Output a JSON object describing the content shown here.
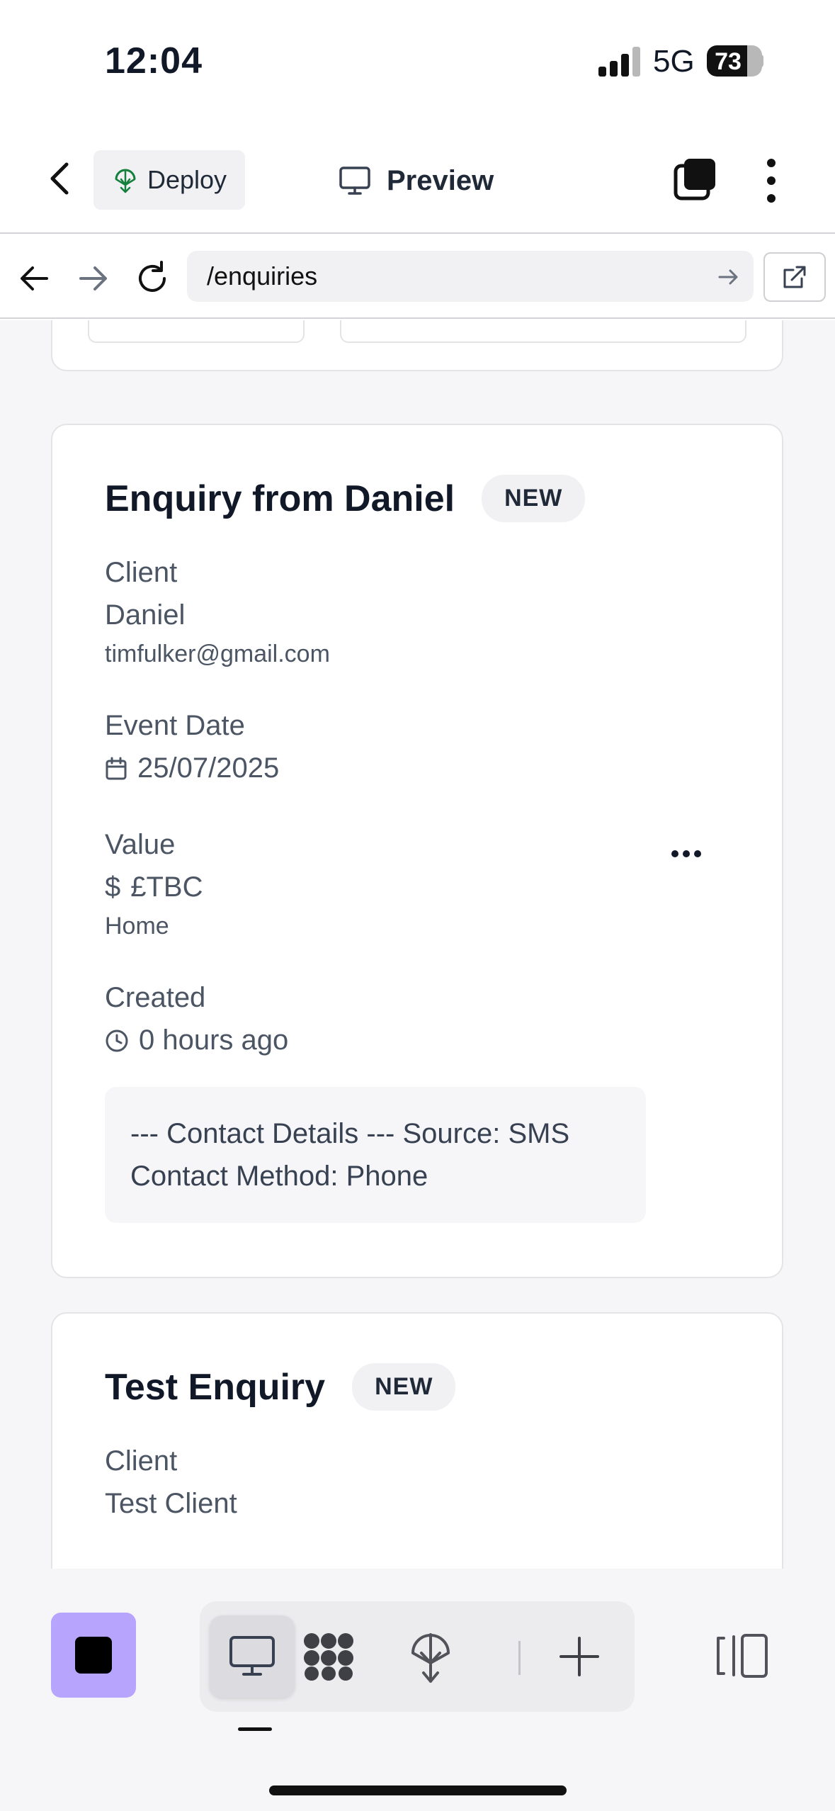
{
  "status_bar": {
    "time": "12:04",
    "network": "5G",
    "battery_percent": "73"
  },
  "header": {
    "deploy_label": "Deploy",
    "preview_label": "Preview",
    "icons": [
      "chevron-left-icon",
      "deploy-icon",
      "monitor-icon",
      "tabs-icon",
      "more-vertical-icon"
    ]
  },
  "browser": {
    "url": "/enquiries"
  },
  "enquiries": [
    {
      "title": "Enquiry from Daniel",
      "status": "NEW",
      "client_label": "Client",
      "client_name": "Daniel",
      "client_email": "timfulker@gmail.com",
      "event_date_label": "Event Date",
      "event_date": "25/07/2025",
      "value_label": "Value",
      "value": "£TBC",
      "value_currency_symbol": "$",
      "venue": "Home",
      "created_label": "Created",
      "created": "0 hours ago",
      "notes": "--- Contact Details --- Source: SMS Contact Method: Phone"
    },
    {
      "title": "Test Enquiry",
      "status": "NEW",
      "client_label": "Client",
      "client_name": "Test Client"
    }
  ],
  "toolbar": {
    "items": [
      "monitor-icon",
      "apps-icon",
      "deploy-icon",
      "plus-icon"
    ],
    "active": "monitor-icon",
    "accent_color": "#b6a4fd"
  }
}
